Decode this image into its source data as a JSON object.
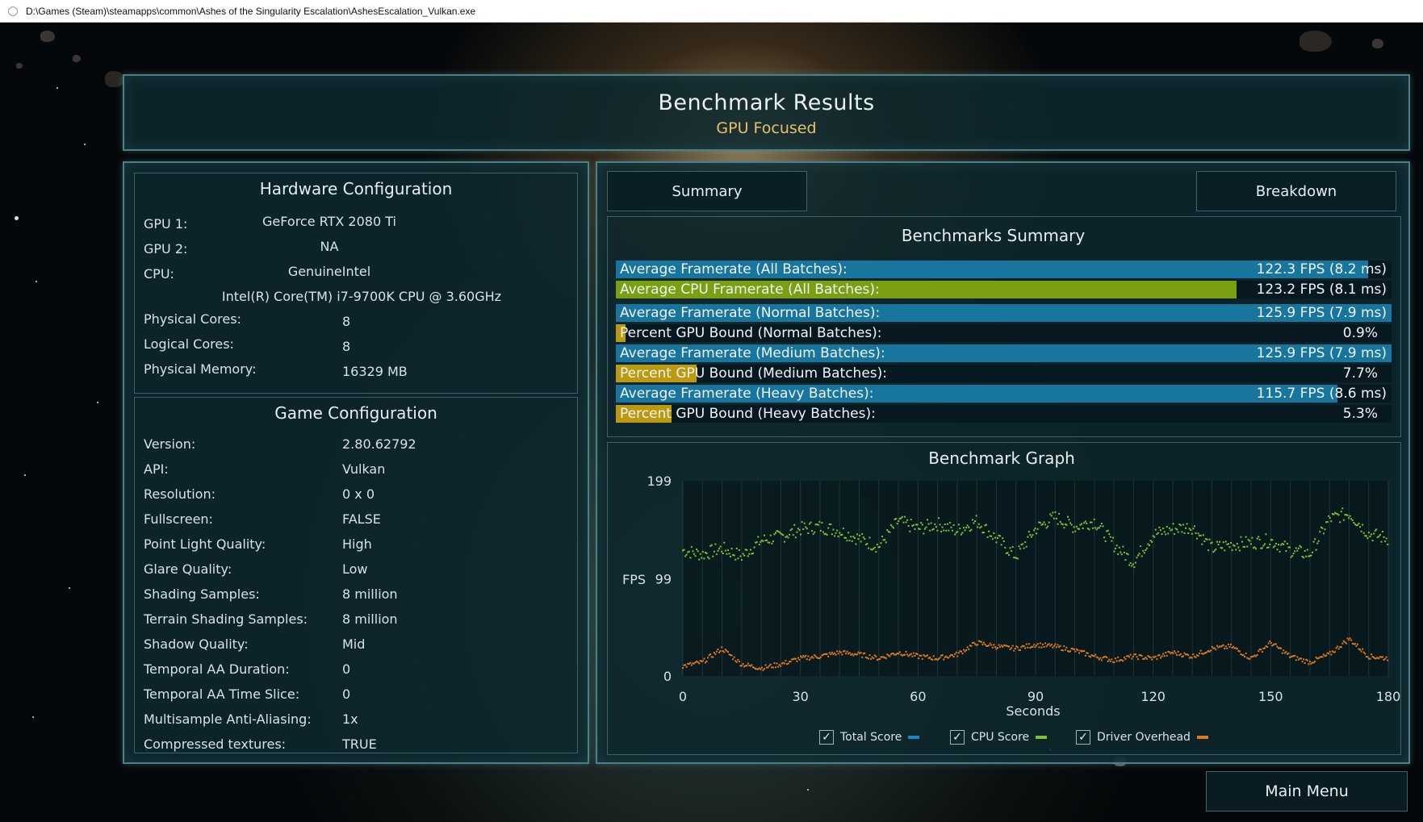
{
  "window": {
    "title": "D:\\Games (Steam)\\steamapps\\common\\Ashes of the Singularity Escalation\\AshesEscalation_Vulkan.exe"
  },
  "header": {
    "title": "Benchmark Results",
    "subtitle": "GPU Focused"
  },
  "hardware": {
    "title": "Hardware Configuration",
    "gpu1_label": "GPU 1:",
    "gpu1_value": "GeForce RTX 2080 Ti",
    "gpu2_label": "GPU 2:",
    "gpu2_value": "NA",
    "cpu_label": "CPU:",
    "cpu_value": "GenuineIntel",
    "cpu_model": "Intel(R) Core(TM) i7-9700K CPU @ 3.60GHz",
    "physical_cores_label": "Physical Cores:",
    "physical_cores_value": "8",
    "logical_cores_label": "Logical Cores:",
    "logical_cores_value": "8",
    "memory_label": "Physical Memory:",
    "memory_value": "16329  MB"
  },
  "game": {
    "title": "Game Configuration",
    "rows": [
      {
        "label": "Version:",
        "value": "2.80.62792"
      },
      {
        "label": "API:",
        "value": "Vulkan"
      },
      {
        "label": "Resolution:",
        "value": "0 x 0"
      },
      {
        "label": "Fullscreen:",
        "value": "FALSE"
      },
      {
        "label": "Point Light Quality:",
        "value": "High"
      },
      {
        "label": "Glare Quality:",
        "value": "Low"
      },
      {
        "label": "Shading Samples:",
        "value": "8 million"
      },
      {
        "label": "Terrain Shading Samples:",
        "value": "8 million"
      },
      {
        "label": "Shadow Quality:",
        "value": "Mid"
      },
      {
        "label": "Temporal AA Duration:",
        "value": "0"
      },
      {
        "label": "Temporal AA Time Slice:",
        "value": "0"
      },
      {
        "label": "Multisample Anti-Aliasing:",
        "value": "1x"
      },
      {
        "label": "Compressed textures:",
        "value": "TRUE"
      }
    ]
  },
  "tabs": {
    "summary": "Summary",
    "breakdown": "Breakdown"
  },
  "summary": {
    "title": "Benchmarks Summary",
    "rows": [
      {
        "label": "Average Framerate (All Batches):",
        "value": "122.3 FPS (8.2 ms)",
        "fill": 0.97,
        "kind": "fps"
      },
      {
        "label": "Average CPU Framerate (All Batches):",
        "value": "123.2 FPS (8.1 ms)",
        "fill": 0.8,
        "kind": "cpu"
      },
      {
        "label": "Average Framerate (Normal Batches):",
        "value": "125.9 FPS (7.9 ms)",
        "fill": 1.0,
        "kind": "fps"
      },
      {
        "label": "Percent GPU Bound (Normal Batches):",
        "value": "0.9%",
        "fill": 0.009,
        "kind": "pct"
      },
      {
        "label": "Average Framerate (Medium Batches):",
        "value": "125.9 FPS (7.9 ms)",
        "fill": 1.0,
        "kind": "fps"
      },
      {
        "label": "Percent GPU Bound (Medium Batches):",
        "value": "7.7%",
        "fill": 0.077,
        "kind": "pct"
      },
      {
        "label": "Average Framerate (Heavy Batches):",
        "value": "115.7 FPS (8.6 ms)",
        "fill": 0.93,
        "kind": "fps"
      },
      {
        "label": "Percent GPU Bound (Heavy Batches):",
        "value": "5.3%",
        "fill": 0.053,
        "kind": "pct"
      }
    ]
  },
  "colors": {
    "fps_bar": "#17759e",
    "cpu_bar": "#7a9f12",
    "pct_bar": "#bb9a12",
    "cpu_series": "#7cc23a",
    "overhead_series": "#e07a1e",
    "total_series": "#1d87c4"
  },
  "graph": {
    "title": "Benchmark Graph",
    "ylabel": "FPS",
    "xlabel": "Seconds",
    "yticks": [
      "199",
      "99",
      "0"
    ],
    "xticks": [
      "0",
      "30",
      "60",
      "90",
      "120",
      "150",
      "180"
    ],
    "legend": [
      {
        "label": "Total Score",
        "color": "#1d87c4"
      },
      {
        "label": "CPU Score",
        "color": "#7cc23a"
      },
      {
        "label": "Driver Overhead",
        "color": "#e07a1e"
      }
    ]
  },
  "chart_data": {
    "type": "scatter",
    "title": "Benchmark Graph",
    "xlabel": "Seconds",
    "ylabel": "FPS",
    "xlim": [
      0,
      180
    ],
    "ylim": [
      0,
      199
    ],
    "x_ticks": [
      0,
      30,
      60,
      90,
      120,
      150,
      180
    ],
    "y_ticks": [
      0,
      99,
      199
    ],
    "legend": "bottom",
    "series": [
      {
        "name": "CPU Score",
        "color": "#7cc23a",
        "x": [
          0,
          5,
          10,
          15,
          20,
          25,
          30,
          35,
          40,
          45,
          50,
          55,
          60,
          65,
          70,
          75,
          80,
          85,
          90,
          95,
          100,
          105,
          110,
          115,
          120,
          125,
          130,
          135,
          140,
          145,
          150,
          155,
          160,
          165,
          170,
          175,
          180
        ],
        "y": [
          128,
          124,
          130,
          122,
          138,
          142,
          150,
          152,
          148,
          140,
          132,
          158,
          150,
          155,
          148,
          158,
          140,
          122,
          150,
          162,
          152,
          158,
          134,
          116,
          144,
          150,
          152,
          130,
          134,
          136,
          138,
          128,
          124,
          160,
          166,
          145,
          140
        ]
      },
      {
        "name": "Driver Overhead",
        "color": "#e07a1e",
        "x": [
          0,
          5,
          10,
          15,
          20,
          25,
          30,
          35,
          40,
          45,
          50,
          55,
          60,
          65,
          70,
          75,
          80,
          85,
          90,
          95,
          100,
          105,
          110,
          115,
          120,
          125,
          130,
          135,
          140,
          145,
          150,
          155,
          160,
          165,
          170,
          175,
          180
        ],
        "y": [
          10,
          14,
          28,
          12,
          8,
          12,
          18,
          20,
          24,
          22,
          18,
          24,
          20,
          18,
          22,
          34,
          30,
          28,
          32,
          30,
          26,
          20,
          16,
          20,
          18,
          24,
          20,
          28,
          30,
          18,
          34,
          20,
          14,
          22,
          38,
          20,
          18
        ]
      }
    ]
  }
}
